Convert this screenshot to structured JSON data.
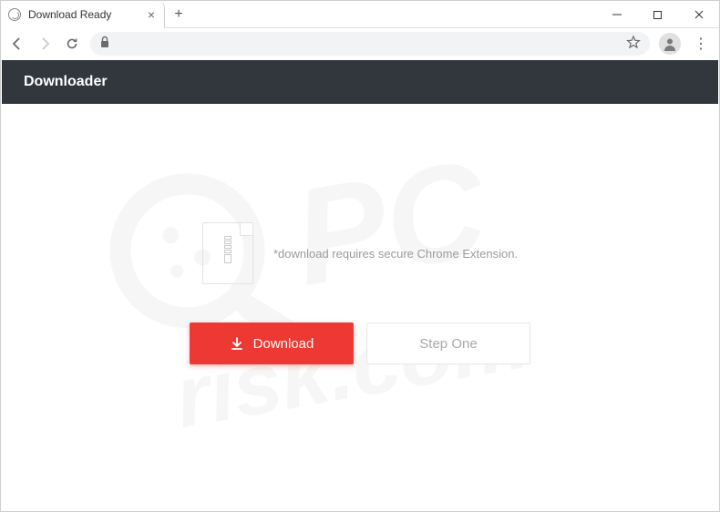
{
  "browser": {
    "tab_title": "Download Ready",
    "address": ""
  },
  "page": {
    "header_title": "Downloader",
    "note": "*download requires secure Chrome Extension.",
    "download_label": "Download",
    "step_label": "Step One"
  },
  "watermark": {
    "line1": "PC",
    "line2": "risk.com"
  }
}
